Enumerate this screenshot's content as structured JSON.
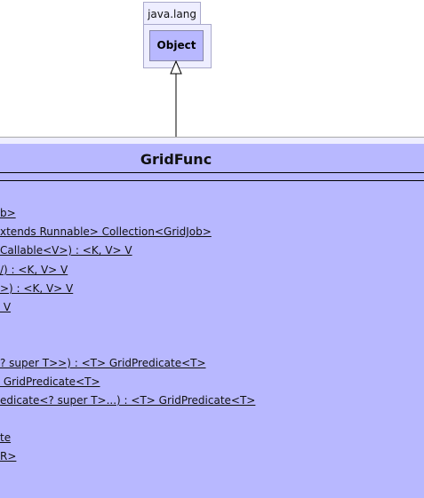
{
  "package": {
    "name": "java.lang"
  },
  "superclass": {
    "name": "Object"
  },
  "class": {
    "name": "GridFunc",
    "fill_color": "#b8b8ff",
    "methods": [
      "b>",
      "xtends Runnable> Collection<GridJob>",
      "Callable<V>) : <K, V> V",
      "/) : <K, V> V",
      ">) : <K, V> V",
      " V",
      "",
      "",
      "? super T>>) : <T> GridPredicate<T>",
      " GridPredicate<T>",
      "edicate<? super T>...) : <T> GridPredicate<T>",
      "",
      "te",
      "R>"
    ]
  }
}
